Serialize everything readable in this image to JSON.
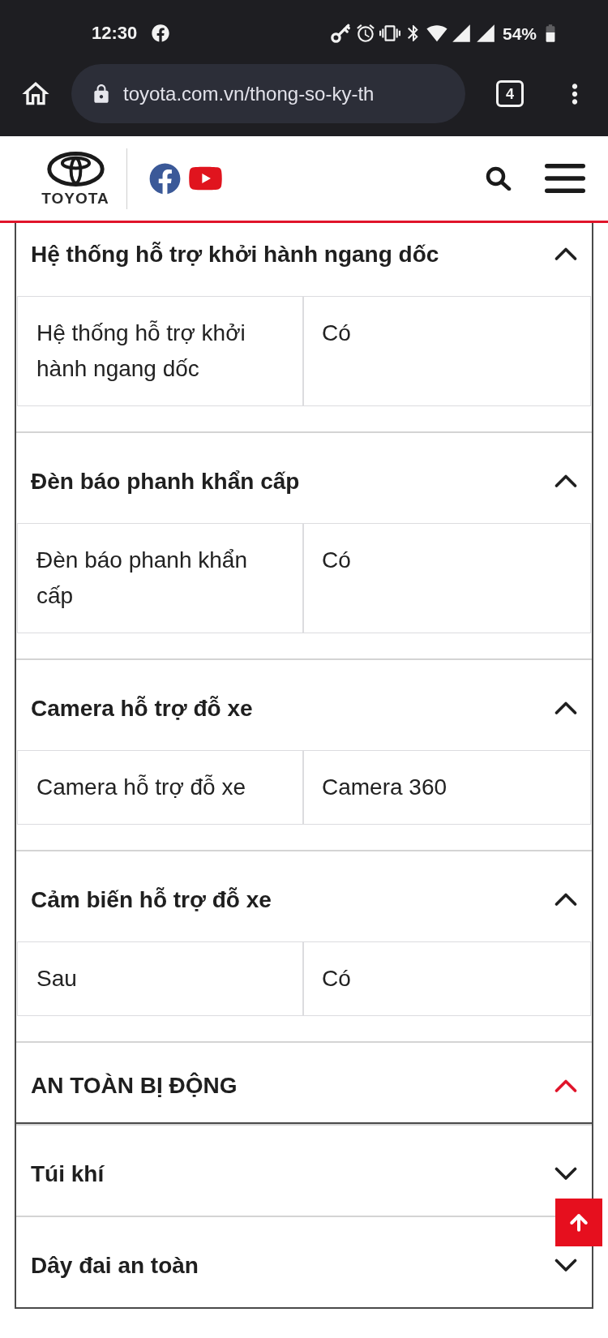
{
  "status_bar": {
    "time": "12:30",
    "battery": "54%"
  },
  "browser": {
    "url": "toyota.com.vn/thong-so-ky-th",
    "tab_count": "4"
  },
  "header": {
    "brand": "TOYOTA"
  },
  "sections": [
    {
      "kind": "feature",
      "title": "Hệ thống hỗ trợ khởi hành ngang dốc",
      "expanded": true,
      "rows": [
        {
          "label": "Hệ thống hỗ trợ khởi hành ngang dốc",
          "value": "Có"
        }
      ]
    },
    {
      "kind": "feature",
      "title": "Đèn báo phanh khẩn cấp",
      "expanded": true,
      "rows": [
        {
          "label": "Đèn báo phanh khẩn cấp",
          "value": "Có"
        }
      ]
    },
    {
      "kind": "feature",
      "title": "Camera hỗ trợ đỗ xe",
      "expanded": true,
      "rows": [
        {
          "label": "Camera hỗ trợ đỗ xe",
          "value": "Camera 360"
        }
      ]
    },
    {
      "kind": "feature",
      "title": "Cảm biến hỗ trợ đỗ xe",
      "expanded": true,
      "rows": [
        {
          "label": "Sau",
          "value": "Có"
        }
      ]
    },
    {
      "kind": "category",
      "title": "AN TOÀN BỊ ĐỘNG",
      "expanded": true
    },
    {
      "kind": "feature",
      "title": "Túi khí",
      "expanded": false
    },
    {
      "kind": "feature",
      "title": "Dây đai an toàn",
      "expanded": false
    }
  ]
}
